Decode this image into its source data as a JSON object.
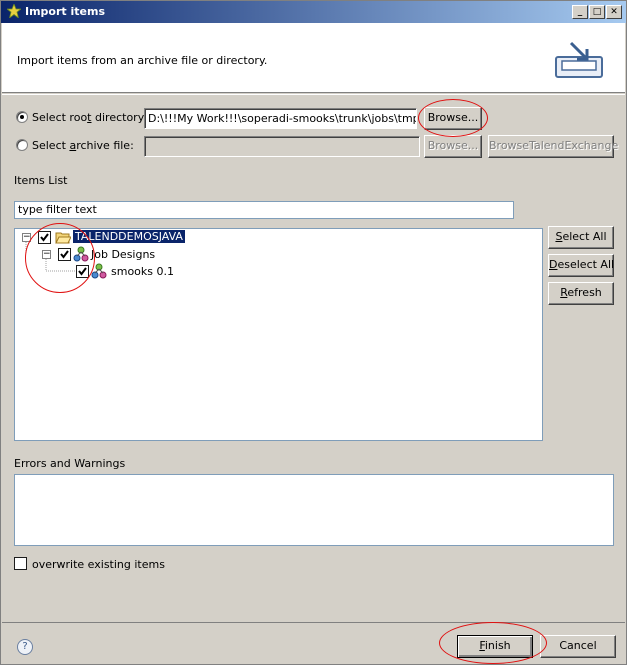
{
  "window": {
    "title": "Import items",
    "min_glyph": "_",
    "max_glyph": "□",
    "close_glyph": "✕"
  },
  "banner": {
    "message": "Import items from an archive file or directory."
  },
  "source": {
    "root_dir_label_pre": "Select roo",
    "root_dir_label_u": "t",
    "root_dir_label_post": " directory:",
    "root_dir_value": "D:\\!!!My Work!!!\\soperadi-smooks\\trunk\\jobs\\tmp\\TALE",
    "root_dir_selected": true,
    "archive_label_pre": "Select ",
    "archive_label_u": "a",
    "archive_label_post": "rchive file:",
    "archive_value": "",
    "browse_label": "Browse...",
    "browse_archive_label": "Browse...",
    "browse_exchange_label": "BrowseTalendExchange"
  },
  "items": {
    "section_label": "Items List",
    "filter_value": "type filter text",
    "tree": [
      {
        "label": "TALENDDEMOSJAVA",
        "checked": true,
        "expanded": true,
        "selected": true
      },
      {
        "label": "Job Designs",
        "checked": true,
        "expanded": true
      },
      {
        "label": "smooks 0.1",
        "checked": true
      }
    ],
    "select_all": {
      "pre": "",
      "u": "S",
      "post": "elect All"
    },
    "deselect_all": {
      "pre": "",
      "u": "D",
      "post": "eselect All"
    },
    "refresh": {
      "pre": "",
      "u": "R",
      "post": "efresh"
    }
  },
  "errors": {
    "section_label": "Errors and Warnings"
  },
  "options": {
    "overwrite_label": "overwrite existing items",
    "overwrite_checked": false
  },
  "footer": {
    "help_glyph": "?",
    "finish": {
      "pre": "",
      "u": "F",
      "post": "inish"
    },
    "cancel_label": "Cancel"
  },
  "colors": {
    "annotation": "#e01010",
    "selection": "#0a246a"
  }
}
